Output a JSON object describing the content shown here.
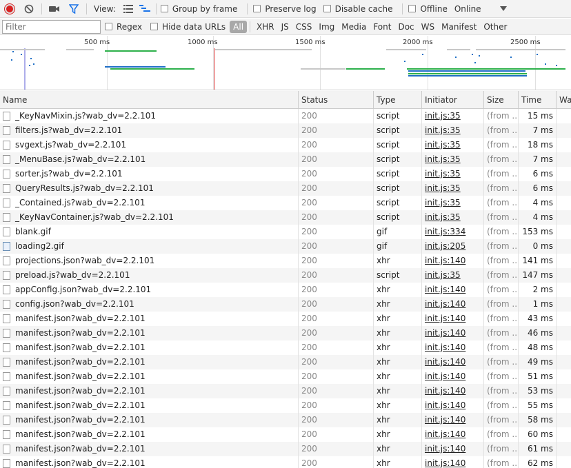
{
  "toolbar": {
    "view_label": "View:",
    "group_by_frame": "Group by frame",
    "preserve_log": "Preserve log",
    "disable_cache": "Disable cache",
    "offline": "Offline",
    "throttle": "Online"
  },
  "filterbar": {
    "placeholder": "Filter",
    "regex": "Regex",
    "hide_data_urls": "Hide data URLs",
    "types": [
      "All",
      "XHR",
      "JS",
      "CSS",
      "Img",
      "Media",
      "Font",
      "Doc",
      "WS",
      "Manifest",
      "Other"
    ]
  },
  "overview": {
    "ticks": [
      "500 ms",
      "1000 ms",
      "1500 ms",
      "2000 ms",
      "2500 ms"
    ],
    "colors": {
      "xhr": "#2db04b",
      "script": "#1f6fc6",
      "marker_blue": "#5b5bd6",
      "marker_red": "#e04444"
    }
  },
  "table": {
    "columns": [
      "Name",
      "Status",
      "Type",
      "Initiator",
      "Size",
      "Time",
      "Wa"
    ],
    "rows": [
      {
        "name": "_KeyNavMixin.js?wab_dv=2.2.101",
        "status": "200",
        "type": "script",
        "initiator": "init.js:35",
        "size": "(from ...",
        "time": "15 ms",
        "icon": "file-icon"
      },
      {
        "name": "filters.js?wab_dv=2.2.101",
        "status": "200",
        "type": "script",
        "initiator": "init.js:35",
        "size": "(from ...",
        "time": "7 ms",
        "icon": "file-icon"
      },
      {
        "name": "svgext.js?wab_dv=2.2.101",
        "status": "200",
        "type": "script",
        "initiator": "init.js:35",
        "size": "(from ...",
        "time": "18 ms",
        "icon": "file-icon"
      },
      {
        "name": "_MenuBase.js?wab_dv=2.2.101",
        "status": "200",
        "type": "script",
        "initiator": "init.js:35",
        "size": "(from ...",
        "time": "7 ms",
        "icon": "file-icon"
      },
      {
        "name": "sorter.js?wab_dv=2.2.101",
        "status": "200",
        "type": "script",
        "initiator": "init.js:35",
        "size": "(from ...",
        "time": "6 ms",
        "icon": "file-icon"
      },
      {
        "name": "QueryResults.js?wab_dv=2.2.101",
        "status": "200",
        "type": "script",
        "initiator": "init.js:35",
        "size": "(from ...",
        "time": "6 ms",
        "icon": "file-icon"
      },
      {
        "name": "_Contained.js?wab_dv=2.2.101",
        "status": "200",
        "type": "script",
        "initiator": "init.js:35",
        "size": "(from ...",
        "time": "4 ms",
        "icon": "file-icon"
      },
      {
        "name": "_KeyNavContainer.js?wab_dv=2.2.101",
        "status": "200",
        "type": "script",
        "initiator": "init.js:35",
        "size": "(from ...",
        "time": "4 ms",
        "icon": "file-icon"
      },
      {
        "name": "blank.gif",
        "status": "200",
        "type": "gif",
        "initiator": "init.js:334",
        "size": "(from ...",
        "time": "153 ms",
        "icon": "file-icon"
      },
      {
        "name": "loading2.gif",
        "status": "200",
        "type": "gif",
        "initiator": "init.js:205",
        "size": "(from ...",
        "time": "0 ms",
        "icon": "image-icon"
      },
      {
        "name": "projections.json?wab_dv=2.2.101",
        "status": "200",
        "type": "xhr",
        "initiator": "init.js:140",
        "size": "(from ...",
        "time": "141 ms",
        "icon": "file-icon"
      },
      {
        "name": "preload.js?wab_dv=2.2.101",
        "status": "200",
        "type": "script",
        "initiator": "init.js:35",
        "size": "(from ...",
        "time": "147 ms",
        "icon": "file-icon"
      },
      {
        "name": "appConfig.json?wab_dv=2.2.101",
        "status": "200",
        "type": "xhr",
        "initiator": "init.js:140",
        "size": "(from ...",
        "time": "2 ms",
        "icon": "file-icon"
      },
      {
        "name": "config.json?wab_dv=2.2.101",
        "status": "200",
        "type": "xhr",
        "initiator": "init.js:140",
        "size": "(from ...",
        "time": "1 ms",
        "icon": "file-icon"
      },
      {
        "name": "manifest.json?wab_dv=2.2.101",
        "status": "200",
        "type": "xhr",
        "initiator": "init.js:140",
        "size": "(from ...",
        "time": "43 ms",
        "icon": "file-icon"
      },
      {
        "name": "manifest.json?wab_dv=2.2.101",
        "status": "200",
        "type": "xhr",
        "initiator": "init.js:140",
        "size": "(from ...",
        "time": "46 ms",
        "icon": "file-icon"
      },
      {
        "name": "manifest.json?wab_dv=2.2.101",
        "status": "200",
        "type": "xhr",
        "initiator": "init.js:140",
        "size": "(from ...",
        "time": "48 ms",
        "icon": "file-icon"
      },
      {
        "name": "manifest.json?wab_dv=2.2.101",
        "status": "200",
        "type": "xhr",
        "initiator": "init.js:140",
        "size": "(from ...",
        "time": "49 ms",
        "icon": "file-icon"
      },
      {
        "name": "manifest.json?wab_dv=2.2.101",
        "status": "200",
        "type": "xhr",
        "initiator": "init.js:140",
        "size": "(from ...",
        "time": "51 ms",
        "icon": "file-icon"
      },
      {
        "name": "manifest.json?wab_dv=2.2.101",
        "status": "200",
        "type": "xhr",
        "initiator": "init.js:140",
        "size": "(from ...",
        "time": "53 ms",
        "icon": "file-icon"
      },
      {
        "name": "manifest.json?wab_dv=2.2.101",
        "status": "200",
        "type": "xhr",
        "initiator": "init.js:140",
        "size": "(from ...",
        "time": "55 ms",
        "icon": "file-icon"
      },
      {
        "name": "manifest.json?wab_dv=2.2.101",
        "status": "200",
        "type": "xhr",
        "initiator": "init.js:140",
        "size": "(from ...",
        "time": "58 ms",
        "icon": "file-icon"
      },
      {
        "name": "manifest.json?wab_dv=2.2.101",
        "status": "200",
        "type": "xhr",
        "initiator": "init.js:140",
        "size": "(from ...",
        "time": "60 ms",
        "icon": "file-icon"
      },
      {
        "name": "manifest.json?wab_dv=2.2.101",
        "status": "200",
        "type": "xhr",
        "initiator": "init.js:140",
        "size": "(from ...",
        "time": "61 ms",
        "icon": "file-icon"
      },
      {
        "name": "manifest.json?wab_dv=2.2.101",
        "status": "200",
        "type": "xhr",
        "initiator": "init.js:140",
        "size": "(from ...",
        "time": "62 ms",
        "icon": "file-icon"
      }
    ]
  }
}
